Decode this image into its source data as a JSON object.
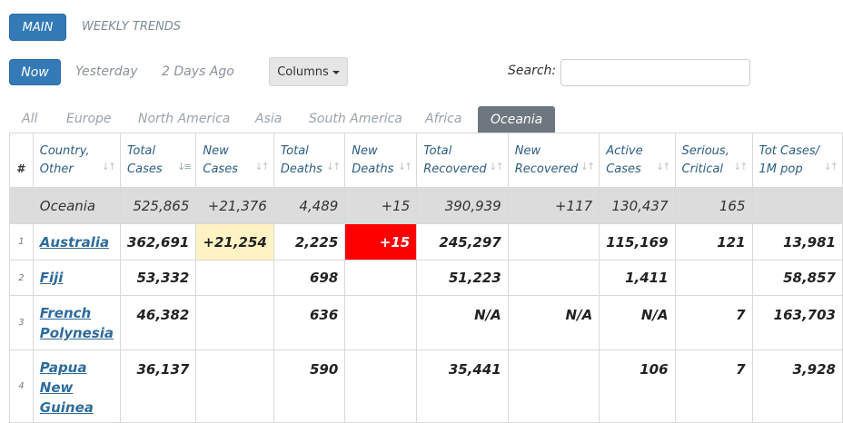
{
  "nav": {
    "main": "MAIN",
    "weekly": "WEEKLY TRENDS"
  },
  "date_tabs": {
    "now": "Now",
    "yesterday": "Yesterday",
    "two_days": "2 Days Ago"
  },
  "columns_button": "Columns",
  "search": {
    "label": "Search:",
    "value": ""
  },
  "regions": [
    "All",
    "Europe",
    "North America",
    "Asia",
    "South America",
    "Africa",
    "Oceania"
  ],
  "active_region": "Oceania",
  "headers": {
    "rank": "#",
    "country": [
      "Country,",
      "Other"
    ],
    "total_cases": [
      "Total",
      "Cases"
    ],
    "new_cases": [
      "New",
      "Cases"
    ],
    "total_deaths": [
      "Total",
      "Deaths"
    ],
    "new_deaths": [
      "New",
      "Deaths"
    ],
    "total_recovered": [
      "Total",
      "Recovered"
    ],
    "new_recovered": [
      "New",
      "Recovered"
    ],
    "active_cases": [
      "Active",
      "Cases"
    ],
    "serious": [
      "Serious,",
      "Critical"
    ],
    "tot_per_m": [
      "Tot Cases/",
      "1M pop"
    ]
  },
  "total_row": {
    "country": "Oceania",
    "total_cases": "525,865",
    "new_cases": "+21,376",
    "total_deaths": "4,489",
    "new_deaths": "+15",
    "total_recovered": "390,939",
    "new_recovered": "+117",
    "active_cases": "130,437",
    "serious": "165",
    "tot_per_m": ""
  },
  "rows": [
    {
      "rank": "1",
      "country": "Australia",
      "total_cases": "362,691",
      "new_cases": "+21,254",
      "total_deaths": "2,225",
      "new_deaths": "+15",
      "total_recovered": "245,297",
      "new_recovered": "",
      "active_cases": "115,169",
      "serious": "121",
      "tot_per_m": "13,981"
    },
    {
      "rank": "2",
      "country": "Fiji",
      "total_cases": "53,332",
      "new_cases": "",
      "total_deaths": "698",
      "new_deaths": "",
      "total_recovered": "51,223",
      "new_recovered": "",
      "active_cases": "1,411",
      "serious": "",
      "tot_per_m": "58,857"
    },
    {
      "rank": "3",
      "country_lines": [
        "French",
        "Polynesia"
      ],
      "total_cases": "46,382",
      "new_cases": "",
      "total_deaths": "636",
      "new_deaths": "",
      "total_recovered": "N/A",
      "new_recovered": "N/A",
      "active_cases": "N/A",
      "serious": "7",
      "tot_per_m": "163,703"
    },
    {
      "rank": "4",
      "country_lines": [
        "Papua",
        "New",
        "Guinea"
      ],
      "total_cases": "36,137",
      "new_cases": "",
      "total_deaths": "590",
      "new_deaths": "",
      "total_recovered": "35,441",
      "new_recovered": "",
      "active_cases": "106",
      "serious": "7",
      "tot_per_m": "3,928"
    }
  ],
  "colors": {
    "accent": "#337ab7",
    "active_tab": "#6e7780",
    "new_cases_highlight": "#fff3c4",
    "new_deaths_highlight": "#ff0000"
  }
}
